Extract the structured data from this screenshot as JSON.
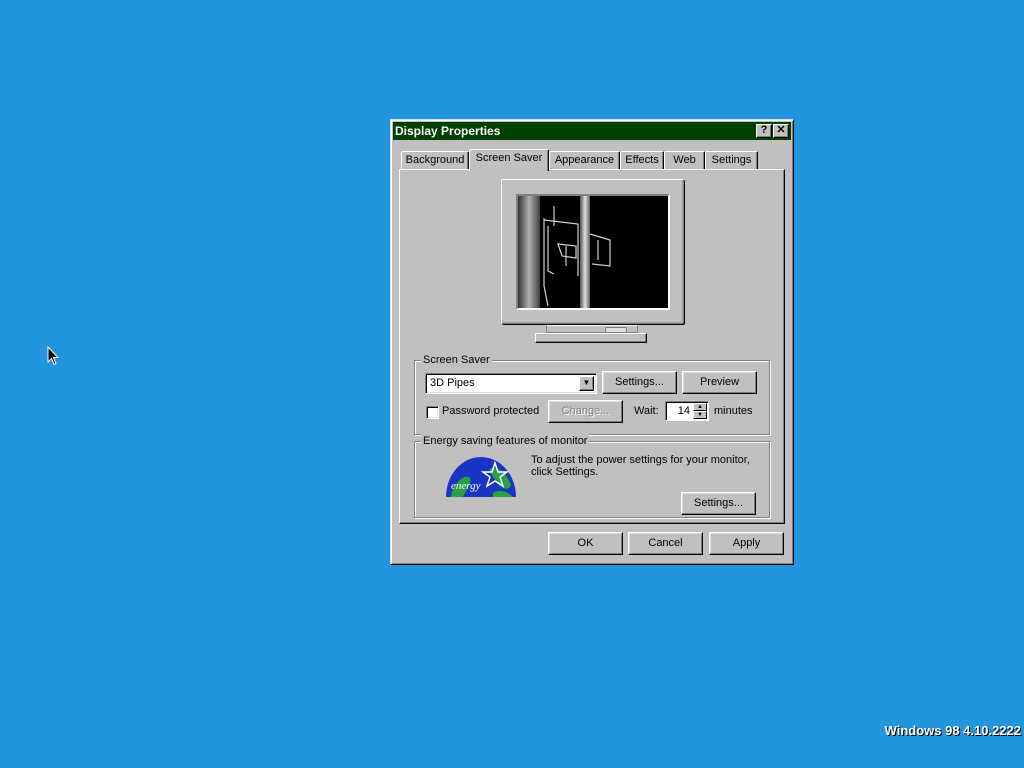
{
  "window": {
    "title": "Display Properties",
    "help_glyph": "?",
    "close_glyph": "✕"
  },
  "tabs": [
    {
      "label": "Background",
      "active": false
    },
    {
      "label": "Screen Saver",
      "active": true
    },
    {
      "label": "Appearance",
      "active": false
    },
    {
      "label": "Effects",
      "active": false
    },
    {
      "label": "Web",
      "active": false
    },
    {
      "label": "Settings",
      "active": false
    }
  ],
  "screensaver": {
    "group_label": "Screen Saver",
    "selected": "3D Pipes",
    "settings_button": "Settings...",
    "preview_button": "Preview",
    "password_label": "Password protected",
    "password_checked": false,
    "change_button": "Change...",
    "wait_label": "Wait:",
    "wait_value": "14",
    "minutes_label": "minutes"
  },
  "energy": {
    "group_label": "Energy saving features of monitor",
    "description": "To adjust the power settings for your monitor, click Settings.",
    "settings_button": "Settings...",
    "logo_text": "energy"
  },
  "footer": {
    "ok": "OK",
    "cancel": "Cancel",
    "apply": "Apply"
  },
  "desktop": {
    "watermark": "Windows 98 4.10.2222",
    "background_color": "#2196dc",
    "titlebar_color": "#004000"
  }
}
